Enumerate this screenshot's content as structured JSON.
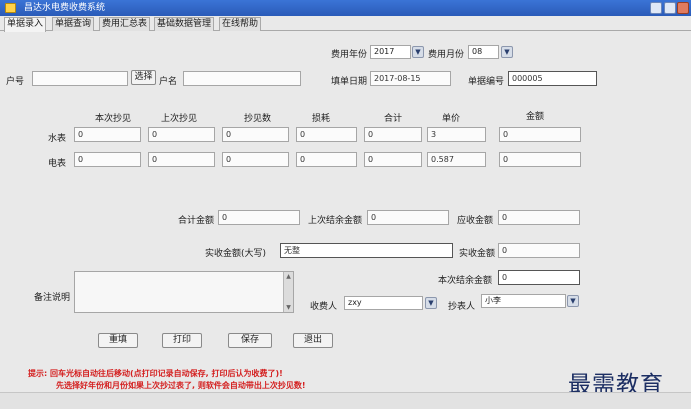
{
  "window": {
    "title": "昌达水电费收费系统"
  },
  "tabs": [
    {
      "label": "单据录入"
    },
    {
      "label": "单据查询"
    },
    {
      "label": "费用汇总表"
    },
    {
      "label": "基础数据管理"
    },
    {
      "label": "在线帮助"
    }
  ],
  "header": {
    "fee_year_label": "费用年份",
    "fee_year_value": "2017",
    "fee_month_label": "费用月份",
    "fee_month_value": "08",
    "account_label": "户号",
    "account_value": "",
    "select_button": "选择",
    "name_label": "户名",
    "name_value": "",
    "date_label": "填单日期",
    "date_value": "2017-08-15",
    "doc_no_label": "单据编号",
    "doc_no_value": "000005"
  },
  "meter": {
    "columns": [
      "本次抄见",
      "上次抄见",
      "抄见数",
      "损耗",
      "合计",
      "单价",
      "金额"
    ],
    "rows": [
      {
        "label": "水表",
        "values": [
          "0",
          "0",
          "0",
          "0",
          "0",
          "3",
          "0"
        ]
      },
      {
        "label": "电表",
        "values": [
          "0",
          "0",
          "0",
          "0",
          "0",
          "0.587",
          "0"
        ]
      }
    ]
  },
  "totals": {
    "total_label": "合计金额",
    "total_value": "0",
    "last_balance_label": "上次结余金额",
    "last_balance_value": "0",
    "receivable_label": "应收金额",
    "receivable_value": "0",
    "received_upper_label": "实收金额(大写)",
    "received_upper_value": "无整",
    "received_label": "实收金额",
    "received_value": "0",
    "current_balance_label": "本次结余金额",
    "current_balance_value": "0"
  },
  "remarks": {
    "label": "备注说明",
    "value": ""
  },
  "collector": {
    "label": "收费人",
    "value": "zxy"
  },
  "reader": {
    "label": "抄表人",
    "value": "小李"
  },
  "buttons": {
    "reset": "重填",
    "print": "打印",
    "save": "保存",
    "exit": "退出"
  },
  "tip": {
    "line1": "提示: 回车光标自动往后移动(点打印记录自动保存, 打印后认为收费了)!",
    "line2": "先选择好年份和月份如果上次抄过表了, 则软件会自动带出上次抄见数!"
  },
  "watermark": "最需教育",
  "colors": {
    "titlebar": "#2a5bb8",
    "tip": "#d41f1f"
  },
  "icons": [
    "app-icon",
    "minimize-icon",
    "maximize-icon",
    "close-icon",
    "dropdown-arrow-icon"
  ]
}
